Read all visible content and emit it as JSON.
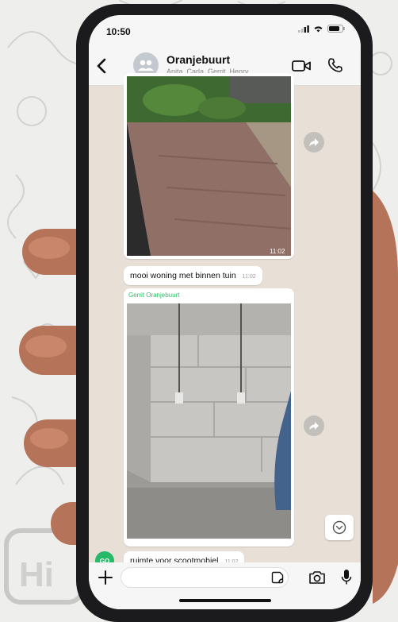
{
  "status_bar": {
    "time": "10:50"
  },
  "chat": {
    "title": "Oranjebuurt",
    "members": "Anita, Carla, Gerrit, Henry, ..."
  },
  "messages": [
    {
      "kind": "photo",
      "content": "brick-path-garden-photo",
      "time": "11:02"
    },
    {
      "kind": "text",
      "text": "mooi woning  met binnen tuin",
      "time": "11:02"
    },
    {
      "kind": "photo",
      "sender": "Gerrit Oranjebuurt",
      "content": "empty-concrete-room-photo"
    },
    {
      "kind": "text",
      "text": "ruimte voor scootmobiel",
      "time": "11:02",
      "avatar_initials": "GO"
    }
  ],
  "input": {
    "placeholder": ""
  },
  "colors": {
    "header_bg": "#f6f6f6",
    "chat_bg": "#e8e0d6",
    "sender_green": "#2dbd6a",
    "avatar_green": "#25b968"
  }
}
